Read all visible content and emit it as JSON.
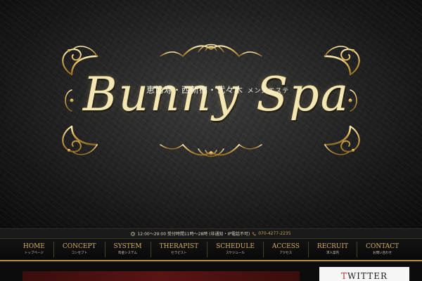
{
  "logo": {
    "wordmark": "Bunny Spa",
    "areas": "恵比寿・西新宿・代々木",
    "tagline": "メンズエステ"
  },
  "info_bar": {
    "clock_icon": "clock-icon",
    "hours": "12:00～29:00 受付時間11時～28時 (非通知・IP電話不可)",
    "phone_icon": "phone-icon",
    "phone": "070-4277-2235"
  },
  "nav": [
    {
      "en": "HOME",
      "ja": "トップページ"
    },
    {
      "en": "CONCEPT",
      "ja": "コンセプト"
    },
    {
      "en": "SYSTEM",
      "ja": "料金システム"
    },
    {
      "en": "THERAPIST",
      "ja": "セラピスト"
    },
    {
      "en": "SCHEDULE",
      "ja": "スケジュール"
    },
    {
      "en": "ACCESS",
      "ja": "アクセス"
    },
    {
      "en": "RECRUIT",
      "ja": "求人案内"
    },
    {
      "en": "CONTACT",
      "ja": "お問い合わせ"
    }
  ],
  "sidebar": {
    "twitter_first": "T",
    "twitter_rest": "WITTER"
  },
  "colors": {
    "gold": "#d6b15d",
    "gold_border": "#b99441",
    "background": "#0d0d0d",
    "accent_red": "#5a1414"
  }
}
